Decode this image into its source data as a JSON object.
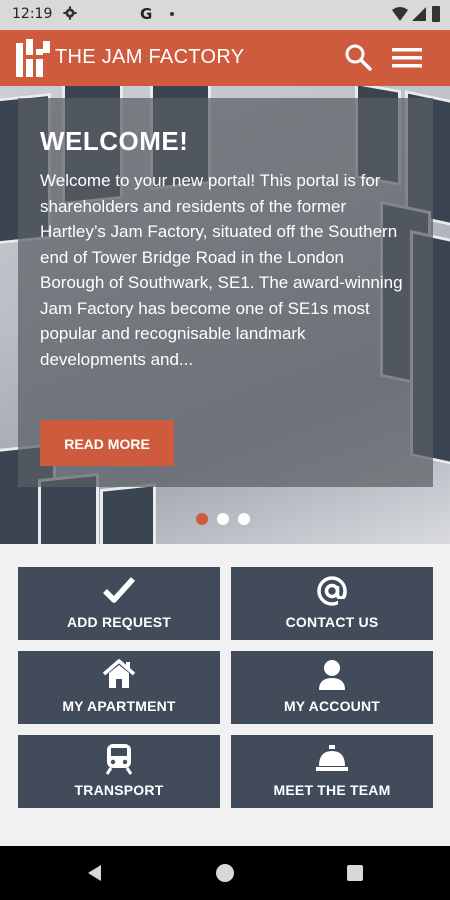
{
  "status_bar": {
    "time": "12:19",
    "app_letter": "G"
  },
  "header": {
    "brand": "THE JAM FACTORY",
    "accent_color": "#cf5b3f"
  },
  "hero": {
    "title": "WELCOME!",
    "text": "Welcome to your new portal! This portal is for shareholders and residents of the former Hartley’s Jam Factory, situated off the Southern end of Tower Bridge Road in the London Borough of Southwark, SE1. The award-winning Jam Factory has become one of SE1s most popular and recognisable landmark developments and...",
    "button": "READ MORE",
    "slides_total": 3,
    "active_slide": 1
  },
  "tiles": [
    {
      "label": "ADD REQUEST",
      "icon": "checkmark-icon"
    },
    {
      "label": "CONTACT US",
      "icon": "at-sign-icon"
    },
    {
      "label": "MY APARTMENT",
      "icon": "house-icon"
    },
    {
      "label": "MY ACCOUNT",
      "icon": "person-icon"
    },
    {
      "label": "TRANSPORT",
      "icon": "train-icon"
    },
    {
      "label": "MEET THE TEAM",
      "icon": "service-bell-icon"
    }
  ],
  "colors": {
    "tile_bg": "#414b5a",
    "page_bg": "#f1f1f1"
  }
}
